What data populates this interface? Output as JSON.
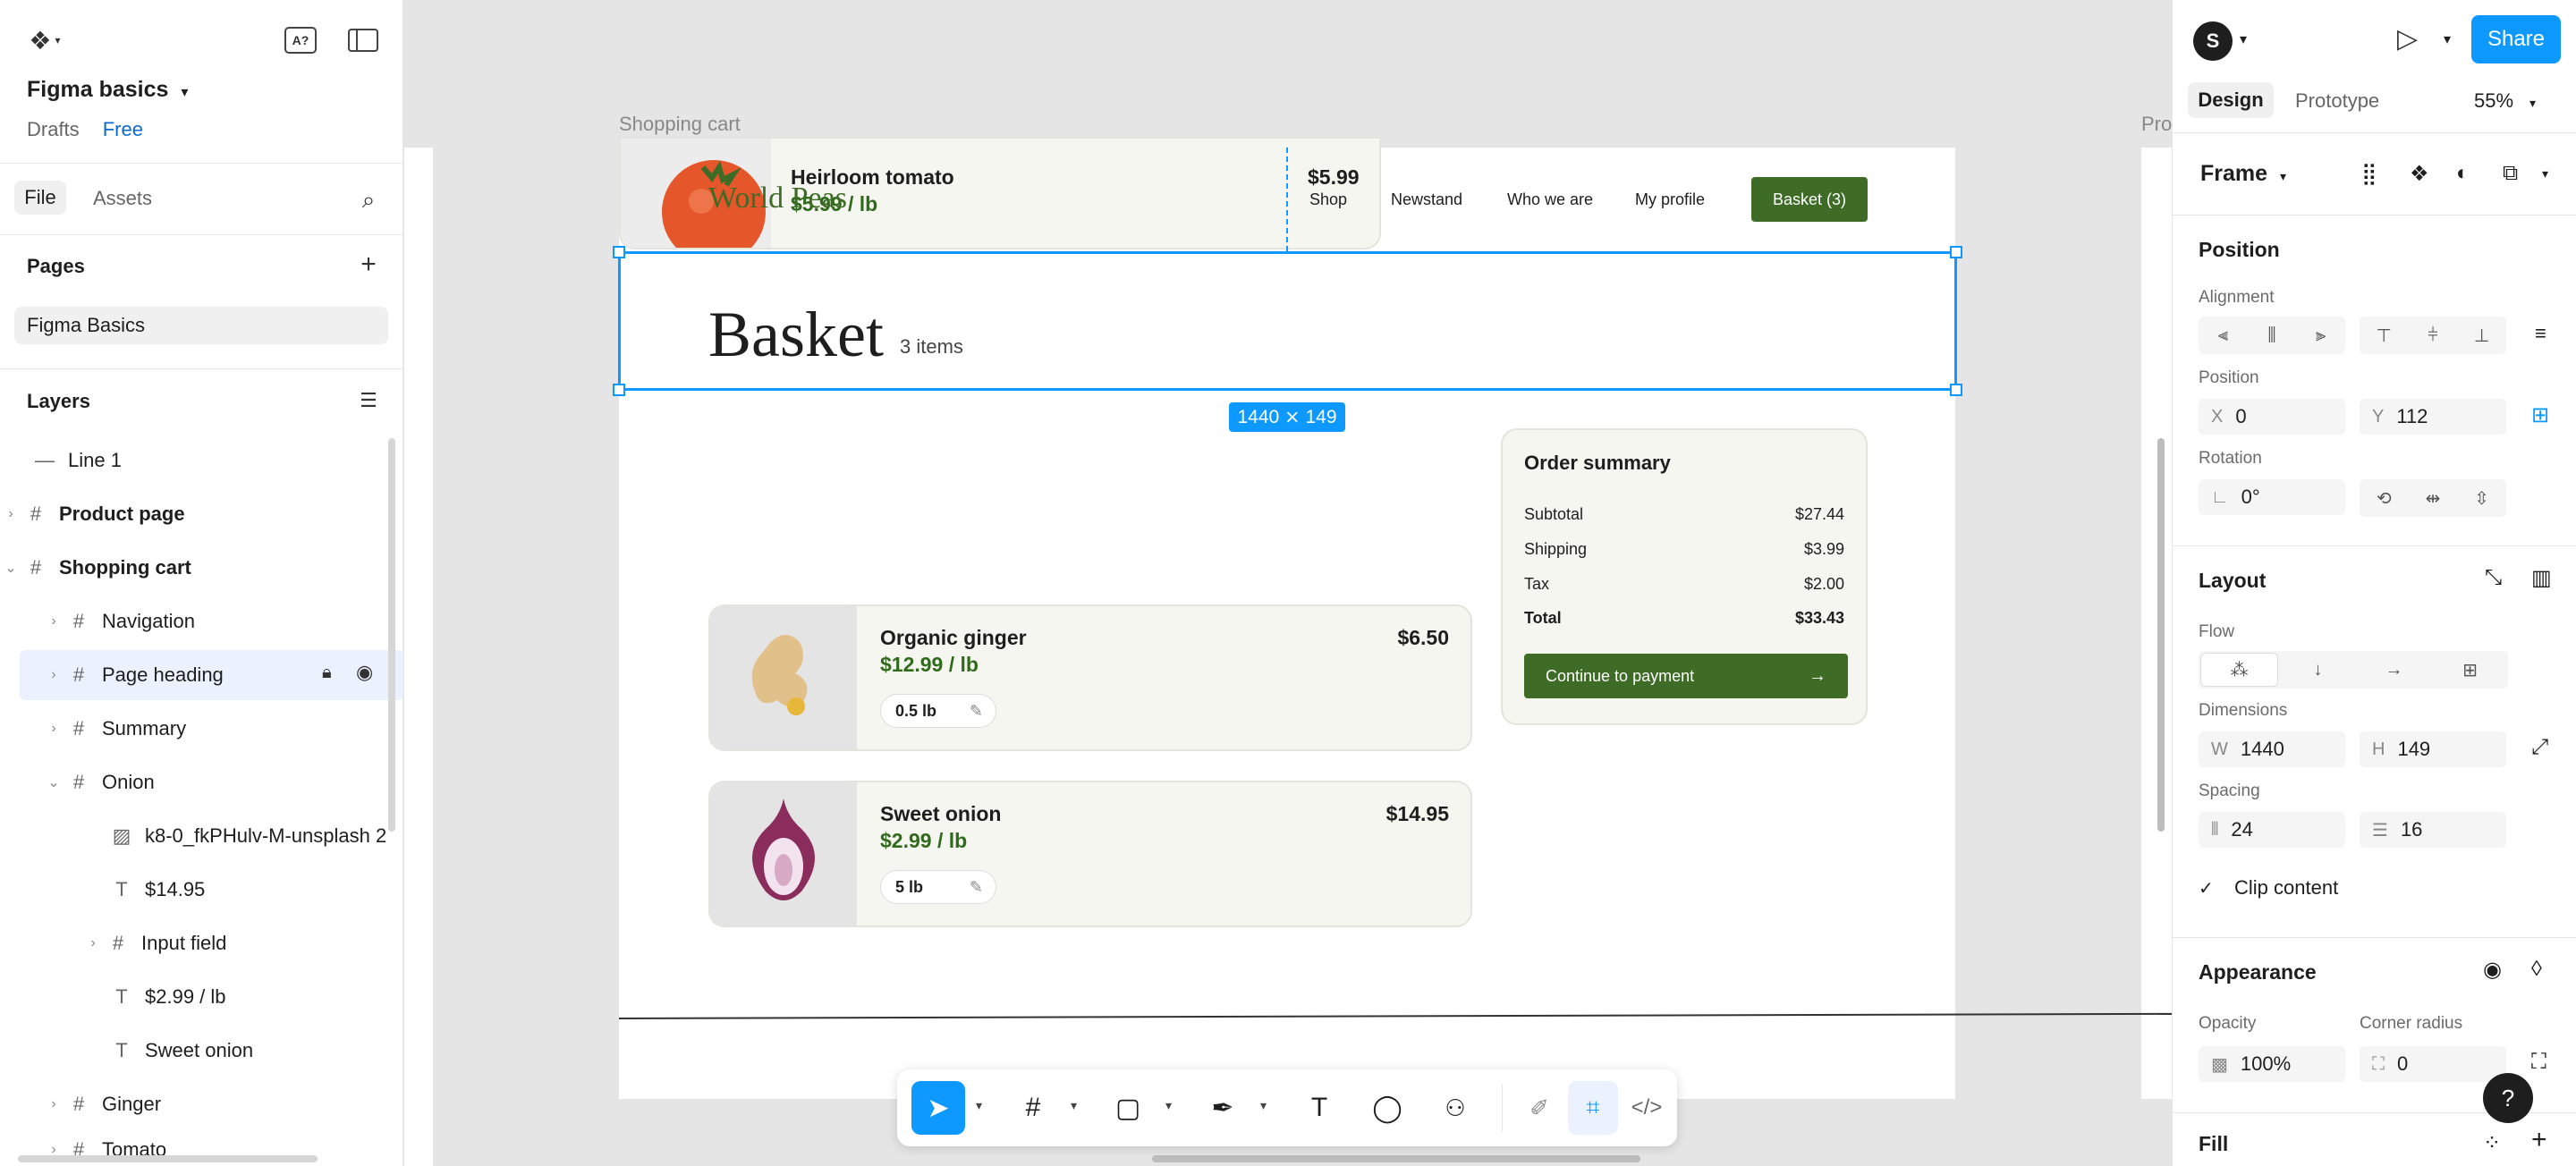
{
  "project": {
    "title": "Figma basics",
    "drafts": "Drafts",
    "plan": "Free"
  },
  "left_tabs": {
    "file": "File",
    "assets": "Assets"
  },
  "pages": {
    "title": "Pages",
    "items": [
      "Figma Basics"
    ]
  },
  "layers": {
    "title": "Layers",
    "items": [
      {
        "name": "Line 1"
      },
      {
        "name": "Product page"
      },
      {
        "name": "Shopping cart"
      },
      {
        "name": "Navigation"
      },
      {
        "name": "Page heading"
      },
      {
        "name": "Summary"
      },
      {
        "name": "Onion"
      },
      {
        "name": "k8-0_fkPHulv-M-unsplash 2"
      },
      {
        "name": "$14.95"
      },
      {
        "name": "Input field"
      },
      {
        "name": "$2.99 / lb"
      },
      {
        "name": "Sweet onion"
      },
      {
        "name": "Ginger"
      },
      {
        "name": "Tomato"
      }
    ]
  },
  "canvas": {
    "frame_label": "Shopping cart",
    "frame_label_right": "Pro",
    "selection_dims": "1440 ⨯ 149",
    "nav": {
      "brand": "World Peas",
      "links": [
        "Shop",
        "Newstand",
        "Who we are",
        "My profile"
      ],
      "basket": "Basket (3)"
    },
    "tomato": {
      "name": "Heirloom tomato",
      "price": "$5.99 / lb",
      "total": "$5.99"
    },
    "heading": {
      "title": "Basket",
      "count": "3 items"
    },
    "products": [
      {
        "name": "Organic ginger",
        "price": "$12.99 / lb",
        "total": "$6.50",
        "qty": "0.5 lb"
      },
      {
        "name": "Sweet onion",
        "price": "$2.99 / lb",
        "total": "$14.95",
        "qty": "5 lb"
      }
    ],
    "summary": {
      "title": "Order summary",
      "rows": [
        {
          "label": "Subtotal",
          "value": "$27.44"
        },
        {
          "label": "Shipping",
          "value": "$3.99"
        },
        {
          "label": "Tax",
          "value": "$2.00"
        },
        {
          "label": "Total",
          "value": "$33.43"
        }
      ],
      "cta": "Continue to payment"
    }
  },
  "right": {
    "avatar": "S",
    "share": "Share",
    "tabs": {
      "design": "Design",
      "prototype": "Prototype"
    },
    "zoom": "55%",
    "frame_type": "Frame",
    "position": {
      "title": "Position",
      "alignment": "Alignment",
      "position_label": "Position",
      "x_label": "X",
      "x": "0",
      "y_label": "Y",
      "y": "112",
      "rotation_label": "Rotation",
      "rotation": "0°"
    },
    "layout": {
      "title": "Layout",
      "flow": "Flow",
      "dimensions": "Dimensions",
      "w_label": "W",
      "w": "1440",
      "h_label": "H",
      "h": "149",
      "spacing": "Spacing",
      "gap_h": "24",
      "gap_v": "16",
      "clip": "Clip content"
    },
    "appearance": {
      "title": "Appearance",
      "opacity_label": "Opacity",
      "opacity": "100%",
      "radius_label": "Corner radius",
      "radius": "0"
    },
    "fill": {
      "title": "Fill"
    }
  },
  "colors": {
    "accent": "#0d99ff",
    "brand_green": "#3e6b26",
    "price_green": "#2f6b1b"
  }
}
